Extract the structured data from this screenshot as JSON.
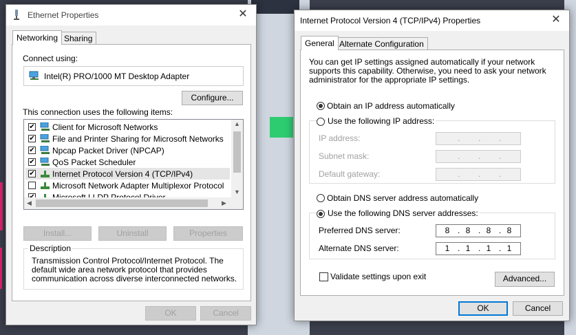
{
  "eth": {
    "title": "Ethernet Properties",
    "tabs": [
      "Networking",
      "Sharing"
    ],
    "connect_using": "Connect using:",
    "adapter": "Intel(R) PRO/1000 MT Desktop Adapter",
    "configure": "Configure...",
    "items_label": "This connection uses the following items:",
    "items": [
      {
        "label": "Client for Microsoft Networks",
        "checked": true
      },
      {
        "label": "File and Printer Sharing for Microsoft Networks",
        "checked": true
      },
      {
        "label": "Npcap Packet Driver (NPCAP)",
        "checked": true
      },
      {
        "label": "QoS Packet Scheduler",
        "checked": true
      },
      {
        "label": "Internet Protocol Version 4 (TCP/IPv4)",
        "checked": true
      },
      {
        "label": "Microsoft Network Adapter Multiplexor Protocol",
        "checked": false
      },
      {
        "label": "Microsoft LLDP Protocol Driver",
        "checked": true
      }
    ],
    "install": "Install...",
    "uninstall": "Uninstall",
    "properties": "Properties",
    "description_label": "Description",
    "description": "Transmission Control Protocol/Internet Protocol. The default wide area network protocol that provides communication across diverse interconnected networks.",
    "ok": "OK",
    "cancel": "Cancel"
  },
  "ipv4": {
    "title": "Internet Protocol Version 4 (TCP/IPv4) Properties",
    "tabs": [
      "General",
      "Alternate Configuration"
    ],
    "intro": "You can get IP settings assigned automatically if your network supports this capability. Otherwise, you need to ask your network administrator for the appropriate IP settings.",
    "obtain_ip_auto": "Obtain an IP address automatically",
    "use_following_ip": "Use the following IP address:",
    "ip_address": "IP address:",
    "subnet_mask": "Subnet mask:",
    "default_gateway": "Default gateway:",
    "obtain_dns_auto": "Obtain DNS server address automatically",
    "use_following_dns": "Use the following DNS server addresses:",
    "preferred_dns": "Preferred DNS server:",
    "preferred_dns_octets": [
      "8",
      "8",
      "8",
      "8"
    ],
    "alternate_dns": "Alternate DNS server:",
    "alternate_dns_octets": [
      "1",
      "1",
      "1",
      "1"
    ],
    "validate": "Validate settings upon exit",
    "advanced": "Advanced...",
    "ok": "OK",
    "cancel": "Cancel"
  },
  "colors": {
    "accent": "#0078d7",
    "selection": "#e5e5e5"
  }
}
